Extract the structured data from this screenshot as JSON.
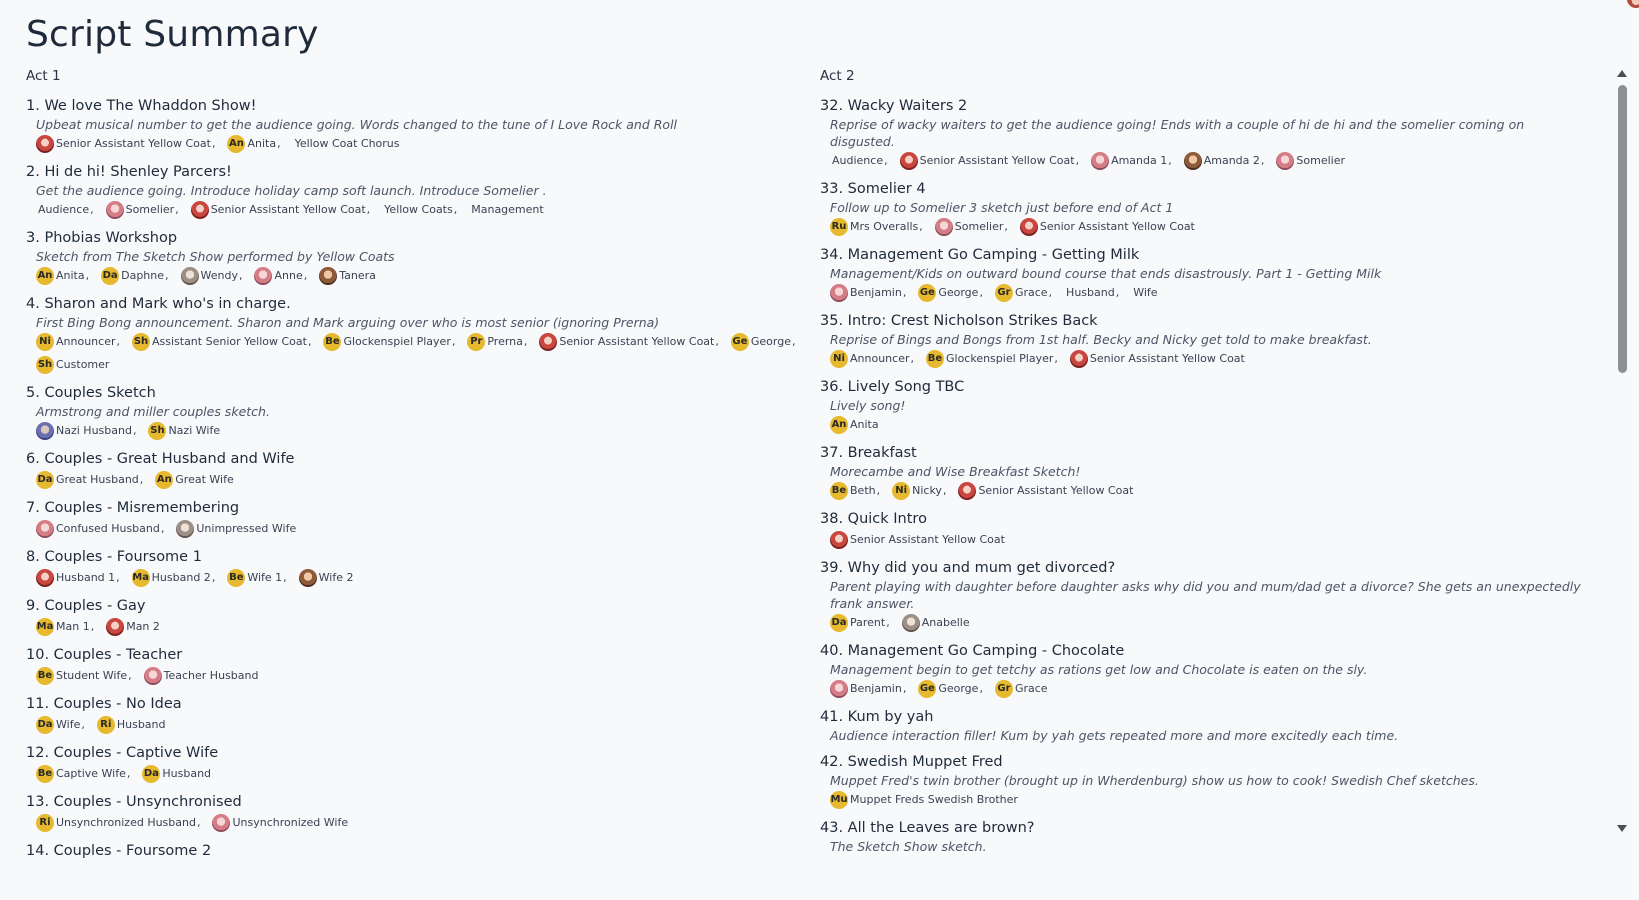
{
  "page": {
    "title": "Script Summary"
  },
  "acts": [
    {
      "label": "Act 1",
      "scenes": [
        {
          "title": "1. We love The Whaddon Show!",
          "desc": "Upbeat musical number to get the audience going. Words changed to the tune of I Love Rock and Roll",
          "cast": [
            {
              "name": "Senior Assistant Yellow Coat",
              "avatar": "photo",
              "tone": "p-red"
            },
            {
              "name": "Anita",
              "avatar": "An"
            },
            {
              "name": "Yellow Coat Chorus",
              "avatar": "none"
            }
          ]
        },
        {
          "title": "2. Hi de hi! Shenley Parcers!",
          "desc": "Get the audience going. Introduce holiday camp soft launch. Introduce Somelier .",
          "cast": [
            {
              "name": "Audience",
              "avatar": "none"
            },
            {
              "name": "Somelier",
              "avatar": "photo",
              "tone": "p-pink"
            },
            {
              "name": "Senior Assistant Yellow Coat",
              "avatar": "photo",
              "tone": "p-red"
            },
            {
              "name": "Yellow Coats",
              "avatar": "none"
            },
            {
              "name": "Management",
              "avatar": "none"
            }
          ]
        },
        {
          "title": "3. Phobias Workshop",
          "desc": "Sketch from The Sketch Show performed by Yellow Coats",
          "cast": [
            {
              "name": "Anita",
              "avatar": "An"
            },
            {
              "name": "Daphne",
              "avatar": "Da"
            },
            {
              "name": "Wendy",
              "avatar": "photo",
              "tone": "p-grey"
            },
            {
              "name": "Anne",
              "avatar": "photo",
              "tone": "p-pink"
            },
            {
              "name": "Tanera",
              "avatar": "photo",
              "tone": "p-brown"
            }
          ]
        },
        {
          "title": "4. Sharon and Mark who's in charge.",
          "desc": "First Bing Bong announcement. Sharon and Mark arguing over who is most senior (ignoring Prerna)",
          "cast": [
            {
              "name": "Announcer",
              "avatar": "Ni"
            },
            {
              "name": "Assistant Senior Yellow Coat",
              "avatar": "Sh"
            },
            {
              "name": "Glockenspiel Player",
              "avatar": "Be"
            },
            {
              "name": "Prerna",
              "avatar": "Pr"
            },
            {
              "name": "Senior Assistant Yellow Coat",
              "avatar": "photo",
              "tone": "p-red"
            },
            {
              "name": "George",
              "avatar": "Ge"
            },
            {
              "name": "Customer",
              "avatar": "Sh"
            }
          ]
        },
        {
          "title": "5. Couples Sketch",
          "desc": "Armstrong and miller couples sketch.",
          "cast": [
            {
              "name": "Nazi Husband",
              "avatar": "photo",
              "tone": "p-blue"
            },
            {
              "name": "Nazi Wife",
              "avatar": "Sh"
            }
          ]
        },
        {
          "title": "6. Couples - Great Husband and Wife",
          "desc": "",
          "cast": [
            {
              "name": "Great Husband",
              "avatar": "Da"
            },
            {
              "name": "Great Wife",
              "avatar": "An"
            }
          ]
        },
        {
          "title": "7. Couples - Misremembering",
          "desc": "",
          "cast": [
            {
              "name": "Confused Husband",
              "avatar": "photo",
              "tone": "p-pink"
            },
            {
              "name": "Unimpressed Wife",
              "avatar": "photo",
              "tone": "p-grey"
            }
          ]
        },
        {
          "title": "8. Couples - Foursome 1",
          "desc": "",
          "cast": [
            {
              "name": "Husband 1",
              "avatar": "photo",
              "tone": "p-red"
            },
            {
              "name": "Husband 2",
              "avatar": "Ma"
            },
            {
              "name": "Wife 1",
              "avatar": "Be"
            },
            {
              "name": "Wife 2",
              "avatar": "photo",
              "tone": "p-brown"
            }
          ]
        },
        {
          "title": "9. Couples - Gay",
          "desc": "",
          "cast": [
            {
              "name": "Man 1",
              "avatar": "Ma"
            },
            {
              "name": "Man 2",
              "avatar": "photo",
              "tone": "p-red"
            }
          ]
        },
        {
          "title": "10. Couples - Teacher",
          "desc": "",
          "cast": [
            {
              "name": "Student Wife",
              "avatar": "Be"
            },
            {
              "name": "Teacher Husband",
              "avatar": "photo",
              "tone": "p-pink"
            }
          ]
        },
        {
          "title": "11. Couples - No Idea",
          "desc": "",
          "cast": [
            {
              "name": "Wife",
              "avatar": "Da"
            },
            {
              "name": "Husband",
              "avatar": "Ri"
            }
          ]
        },
        {
          "title": "12. Couples - Captive Wife",
          "desc": "",
          "cast": [
            {
              "name": "Captive Wife",
              "avatar": "Be"
            },
            {
              "name": "Husband",
              "avatar": "Da"
            }
          ]
        },
        {
          "title": "13. Couples - Unsynchronised",
          "desc": "",
          "cast": [
            {
              "name": "Unsynchronized Husband",
              "avatar": "Ri"
            },
            {
              "name": "Unsynchronized Wife",
              "avatar": "photo",
              "tone": "p-pink"
            }
          ]
        },
        {
          "title": "14. Couples - Foursome 2",
          "desc": "",
          "cast": []
        }
      ]
    },
    {
      "label": "Act 2",
      "scenes": [
        {
          "title": "32. Wacky Waiters 2",
          "desc": "Reprise of wacky waiters to get the audience going! Ends with a couple of hi de hi and the somelier coming on disgusted.",
          "cast": [
            {
              "name": "Audience",
              "avatar": "none"
            },
            {
              "name": "Senior Assistant Yellow Coat",
              "avatar": "photo",
              "tone": "p-red"
            },
            {
              "name": "Amanda 1",
              "avatar": "photo",
              "tone": "p-pink"
            },
            {
              "name": "Amanda 2",
              "avatar": "photo",
              "tone": "p-brown"
            },
            {
              "name": "Somelier",
              "avatar": "photo",
              "tone": "p-pink"
            }
          ]
        },
        {
          "title": "33. Somelier 4",
          "desc": "Follow up to Somelier 3 sketch just before end of Act 1",
          "cast": [
            {
              "name": "Mrs Overalls",
              "avatar": "Ru"
            },
            {
              "name": "Somelier",
              "avatar": "photo",
              "tone": "p-pink"
            },
            {
              "name": "Senior Assistant Yellow Coat",
              "avatar": "photo",
              "tone": "p-red"
            }
          ]
        },
        {
          "title": "34. Management Go Camping - Getting Milk",
          "desc": "Management/Kids on outward bound course that ends disastrously. Part 1 - Getting Milk",
          "cast": [
            {
              "name": "Benjamin",
              "avatar": "photo",
              "tone": "p-pink"
            },
            {
              "name": "George",
              "avatar": "Ge"
            },
            {
              "name": "Grace",
              "avatar": "Gr"
            },
            {
              "name": "Husband",
              "avatar": "none"
            },
            {
              "name": "Wife",
              "avatar": "none"
            }
          ]
        },
        {
          "title": "35. Intro: Crest Nicholson Strikes Back",
          "desc": "Reprise of Bings and Bongs from 1st half. Becky and Nicky get told to make breakfast.",
          "cast": [
            {
              "name": "Announcer",
              "avatar": "Ni"
            },
            {
              "name": "Glockenspiel Player",
              "avatar": "Be"
            },
            {
              "name": "Senior Assistant Yellow Coat",
              "avatar": "photo",
              "tone": "p-red"
            }
          ]
        },
        {
          "title": "36. Lively Song TBC",
          "desc": "Lively song!",
          "cast": [
            {
              "name": "Anita",
              "avatar": "An"
            }
          ]
        },
        {
          "title": "37. Breakfast",
          "desc": "Morecambe and Wise Breakfast Sketch!",
          "cast": [
            {
              "name": "Beth",
              "avatar": "Be"
            },
            {
              "name": "Nicky",
              "avatar": "Ni"
            },
            {
              "name": "Senior Assistant Yellow Coat",
              "avatar": "photo",
              "tone": "p-red"
            }
          ]
        },
        {
          "title": "38. Quick Intro",
          "desc": "",
          "cast": [
            {
              "name": "Senior Assistant Yellow Coat",
              "avatar": "photo",
              "tone": "p-red"
            }
          ]
        },
        {
          "title": "39. Why did you and mum get divorced?",
          "desc": "Parent playing with daughter before daughter asks why did you and mum/dad get a divorce? She gets an unexpectedly frank answer.",
          "cast": [
            {
              "name": "Parent",
              "avatar": "Da"
            },
            {
              "name": "Anabelle",
              "avatar": "photo",
              "tone": "p-grey"
            }
          ]
        },
        {
          "title": "40. Management Go Camping - Chocolate",
          "desc": "Management begin to get tetchy as rations get low and Chocolate is eaten on the sly.",
          "cast": [
            {
              "name": "Benjamin",
              "avatar": "photo",
              "tone": "p-pink"
            },
            {
              "name": "George",
              "avatar": "Ge"
            },
            {
              "name": "Grace",
              "avatar": "Gr"
            }
          ]
        },
        {
          "title": "41. Kum by yah",
          "desc": "Audience interaction filler! Kum by yah gets repeated more and more excitedly each time.",
          "cast": []
        },
        {
          "title": "42. Swedish Muppet Fred",
          "desc": "Muppet Fred's twin brother (brought up in Wherdenburg) show us how to cook! Swedish Chef sketches.",
          "cast": [
            {
              "name": "Muppet Freds Swedish Brother",
              "avatar": "Mu"
            }
          ]
        },
        {
          "title": "43. All the Leaves are brown?",
          "desc": "The Sketch Show sketch.",
          "cast": []
        }
      ]
    }
  ]
}
